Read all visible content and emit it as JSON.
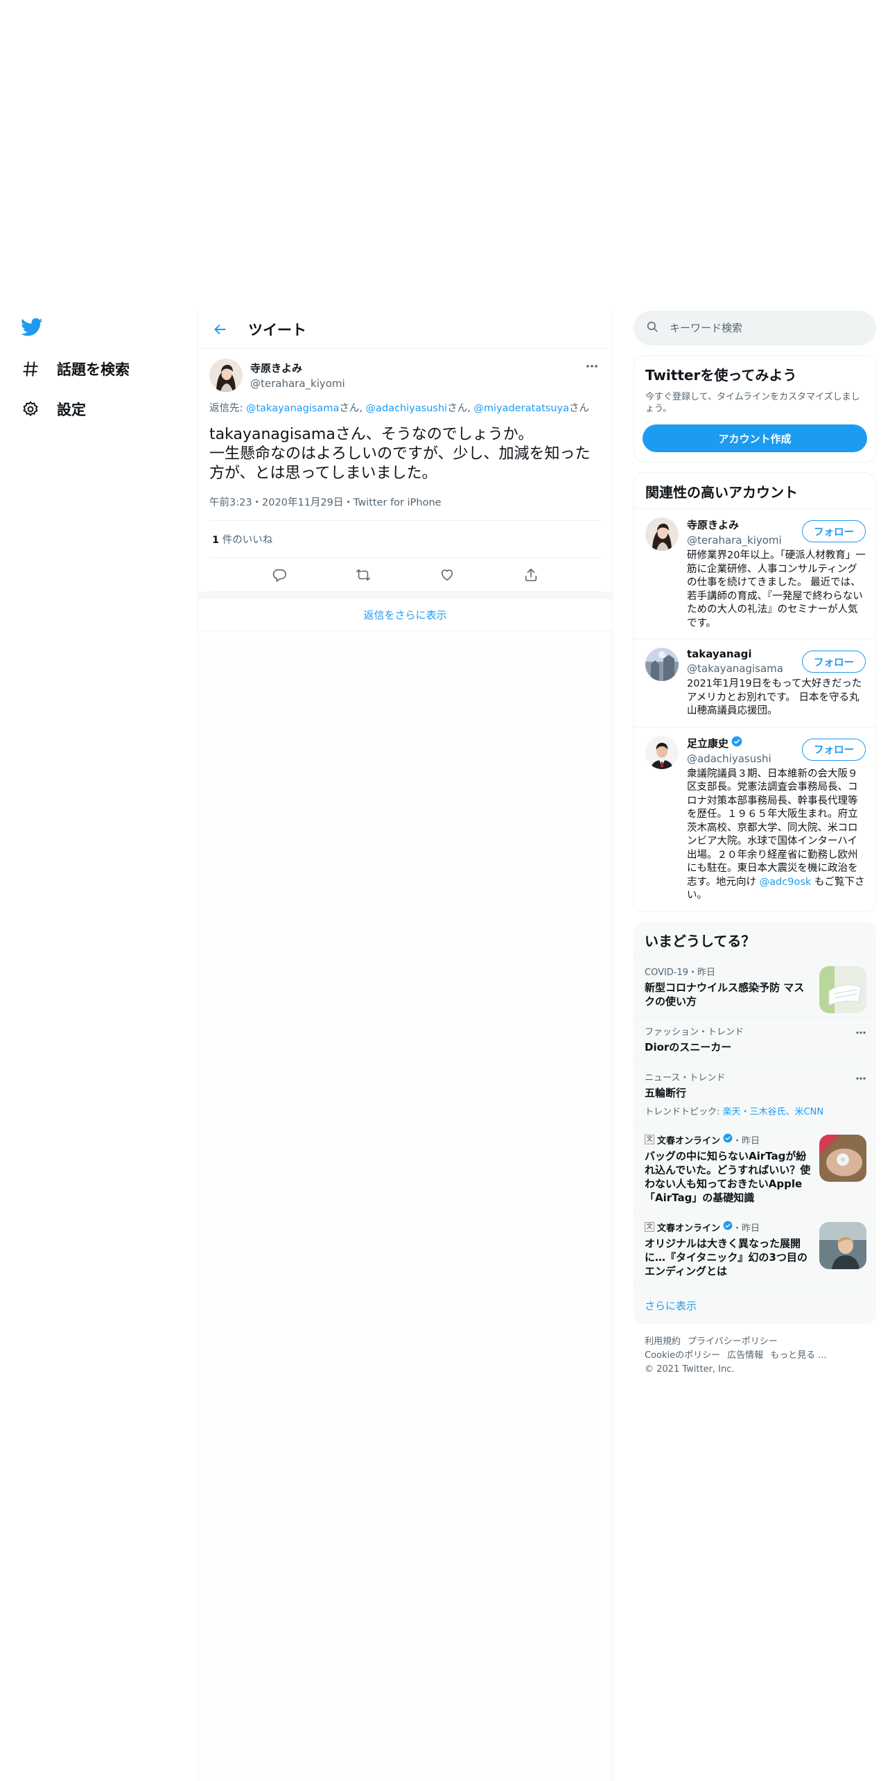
{
  "nav": {
    "items": [
      {
        "label": "話題を検索",
        "icon": "hashtag-icon"
      },
      {
        "label": "設定",
        "icon": "gear-icon"
      }
    ]
  },
  "main": {
    "header_title": "ツイート",
    "tweet": {
      "name": "寺原きよみ",
      "handle": "@terahara_kiyomi",
      "reply_prefix": "返信先: ",
      "reply_to": [
        {
          "handle": "@takayanagisama",
          "suffix": "さん, "
        },
        {
          "handle": "@adachiyasushi",
          "suffix": "さん, "
        },
        {
          "handle": "@miyaderatatsuya",
          "suffix": "さん"
        }
      ],
      "text": "takayanagisamaさん、そうなのでしょうか。\n一生懸命なのはよろしいのですが、少し、加減を知った方が、とは思ってしまいました。",
      "meta": "午前3:23・2020年11月29日・Twitter for iPhone",
      "like_count": "1",
      "like_label": " 件のいいね"
    },
    "show_more_replies": "返信をさらに表示"
  },
  "side": {
    "search_placeholder": "キーワード検索",
    "signup": {
      "title": "Twitterを使ってみよう",
      "subtitle": "今すぐ登録して、タイムラインをカスタマイズしましょう。",
      "button": "アカウント作成"
    },
    "relevant": {
      "title": "関連性の高いアカウント",
      "follow_label": "フォロー",
      "accounts": [
        {
          "name": "寺原きよみ",
          "handle": "@terahara_kiyomi",
          "bio": "研修業界20年以上。「硬派人材教育」一筋に企業研修、人事コンサルティングの仕事を続けてきました。 最近では、若手講師の育成、『一発屋で終わらないための大人の礼法』のセミナーが人気です。"
        },
        {
          "name": "takayanagi",
          "handle": "@takayanagisama",
          "bio": "2021年1月19日をもって大好きだったアメリカとお別れです。 日本を守る丸山穂高議員応援団。"
        },
        {
          "name": "足立康史",
          "handle": "@adachiyasushi",
          "bio": "衆議院議員３期、日本維新の会大阪９区支部長。党憲法調査会事務局長、コロナ対策本部事務局長、幹事長代理等を歴任。１９６５年大阪生まれ。府立茨木高校、京都大学、同大院、米コロンビア大院。水球で国体インターハイ出場。２０年余り経産省に勤務し欧州にも駐在。東日本大震災を機に政治を志す。地元向け ",
          "bio_link": "@adc9osk",
          "bio_tail": " もご覧下さい。"
        }
      ]
    },
    "trends": {
      "title": "いまどうしてる？",
      "items": [
        {
          "context": "COVID-19・昨日",
          "title": "新型コロナウイルス感染予防 マスクの使い方"
        },
        {
          "context": "ファッション・トレンド",
          "title": "Diorのスニーカー"
        },
        {
          "context": "ニュース・トレンド",
          "title": "五輪断行",
          "sub_prefix": "トレンドトピック: ",
          "sub_link": "楽天・三木谷氏、米CNN"
        },
        {
          "context_source": "文春オンライン",
          "context_time": "・昨日",
          "title": "バッグの中に知らないAirTagが紛れ込んでいた。どうすればいい？使わない人も知っておきたいApple「AirTag」の基礎知識"
        },
        {
          "context_source": "文春オンライン",
          "context_time": "・昨日",
          "title": "オリジナルは大きく異なった展開に…『タイタニック』幻の3つ目のエンディングとは"
        }
      ],
      "show_more": "さらに表示"
    },
    "footer": {
      "links": [
        "利用規約",
        "プライバシーポリシー",
        "Cookieのポリシー",
        "広告情報",
        "もっと見る ..."
      ],
      "copyright": "© 2021 Twitter, Inc."
    }
  },
  "colors": {
    "accent": "#1d9bf0",
    "muted": "#536471",
    "border": "#eff3f4"
  }
}
